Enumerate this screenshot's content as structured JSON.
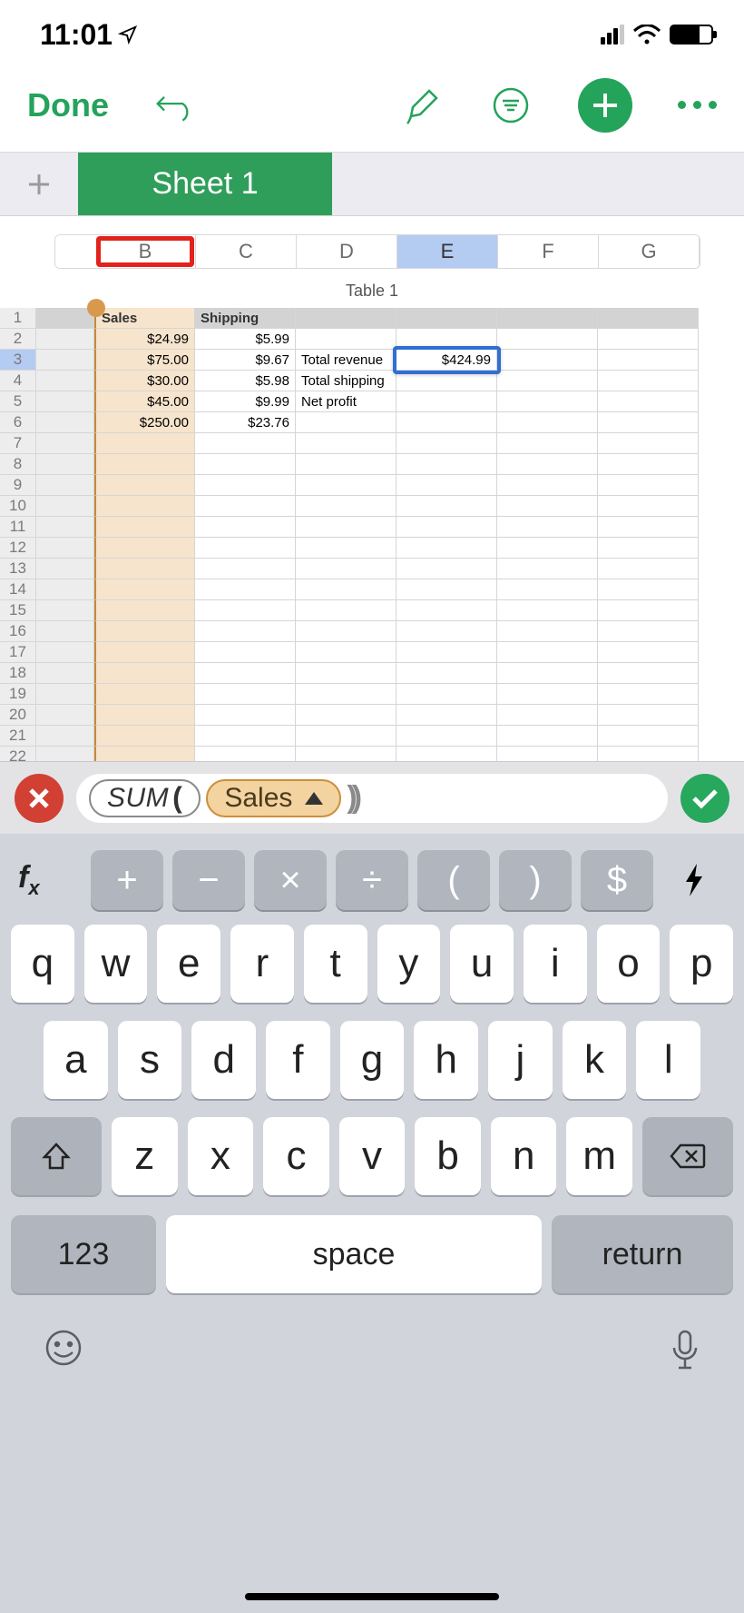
{
  "status": {
    "time": "11:01"
  },
  "toolbar": {
    "done": "Done"
  },
  "sheet": {
    "active_tab": "Sheet 1",
    "table_title": "Table 1"
  },
  "columns": [
    "B",
    "C",
    "D",
    "E",
    "F",
    "G"
  ],
  "highlighted_column": "B",
  "selected_column": "E",
  "row_numbers": [
    "1",
    "2",
    "3",
    "4",
    "5",
    "6",
    "7",
    "8",
    "9",
    "10",
    "11",
    "12",
    "13",
    "14",
    "15",
    "16",
    "17",
    "18",
    "19",
    "20",
    "21",
    "22"
  ],
  "selected_row": "3",
  "headers": {
    "B": "Sales",
    "C": "Shipping"
  },
  "rows": [
    {
      "B": "$24.99",
      "C": "$5.99",
      "D": "",
      "E": ""
    },
    {
      "B": "$75.00",
      "C": "$9.67",
      "D": "Total  revenue",
      "E": "$424.99"
    },
    {
      "B": "$30.00",
      "C": "$5.98",
      "D": "Total shipping",
      "E": ""
    },
    {
      "B": "$45.00",
      "C": "$9.99",
      "D": "Net profit",
      "E": ""
    },
    {
      "B": "$250.00",
      "C": "$23.76",
      "D": "",
      "E": ""
    }
  ],
  "active_cell": {
    "col": "E",
    "row": 3,
    "value": "$424.99"
  },
  "formula": {
    "func": "SUM",
    "arg": "Sales",
    "close": "))"
  },
  "operators": [
    "+",
    "−",
    "×",
    "÷",
    "(",
    ")",
    "$"
  ],
  "keys": {
    "r1": [
      "q",
      "w",
      "e",
      "r",
      "t",
      "y",
      "u",
      "i",
      "o",
      "p"
    ],
    "r2": [
      "a",
      "s",
      "d",
      "f",
      "g",
      "h",
      "j",
      "k",
      "l"
    ],
    "r3": [
      "z",
      "x",
      "c",
      "v",
      "b",
      "n",
      "m"
    ],
    "num": "123",
    "space": "space",
    "ret": "return"
  },
  "fx_label": "f"
}
